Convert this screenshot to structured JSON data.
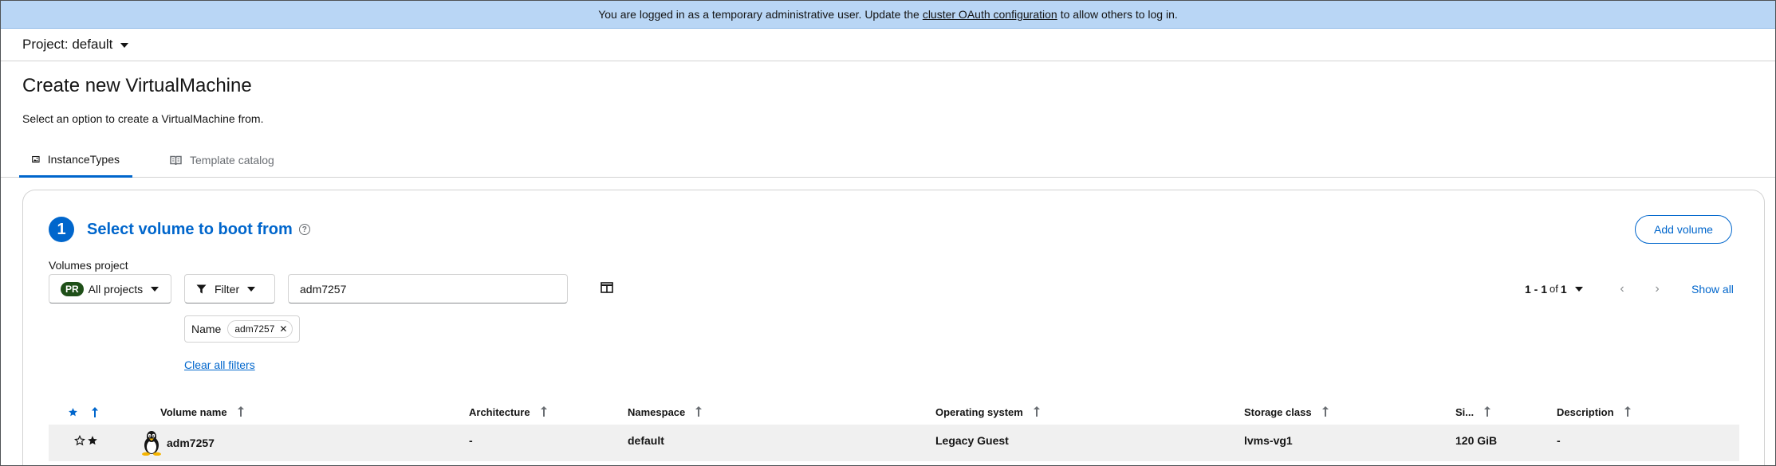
{
  "banner": {
    "text_before": "You are logged in as a temporary administrative user. Update the",
    "link": "cluster OAuth configuration",
    "text_after": "to allow others to log in."
  },
  "project": {
    "label": "Project: default"
  },
  "page": {
    "title": "Create new VirtualMachine",
    "subtitle": "Select an option to create a VirtualMachine from."
  },
  "tabs": [
    {
      "label": "InstanceTypes",
      "icon": "image-icon",
      "active": true
    },
    {
      "label": "Template catalog",
      "icon": "book-icon",
      "active": false
    }
  ],
  "step": {
    "number": "1",
    "title": "Select volume to boot from",
    "help": "?",
    "add_volume_label": "Add volume"
  },
  "toolbar": {
    "volumes_project_label": "Volumes project",
    "project_badge": "PR",
    "project_value": "All projects",
    "filter_label": "Filter",
    "search_value": "adm7257",
    "pagination": {
      "range": "1 - 1",
      "of": "of",
      "total": "1"
    },
    "prev": "‹",
    "next": "›",
    "show_all": "Show all"
  },
  "chips": {
    "category": "Name",
    "value": "adm7257",
    "remove": "✕",
    "clear_all": "Clear all filters"
  },
  "table": {
    "columns": [
      "Volume name",
      "Architecture",
      "Namespace",
      "Operating system",
      "Storage class",
      "Si...",
      "Description"
    ],
    "rows": [
      {
        "volume_name": "adm7257",
        "architecture": "-",
        "namespace": "default",
        "operating_system": "Legacy Guest",
        "storage_class": "lvms-vg1",
        "size": "120 GiB",
        "description": "-"
      }
    ]
  },
  "colors": {
    "accent": "#0066cc",
    "banner": "#b9d6f5",
    "badge": "#1e4f18",
    "row_bg": "#f0f0f0"
  }
}
